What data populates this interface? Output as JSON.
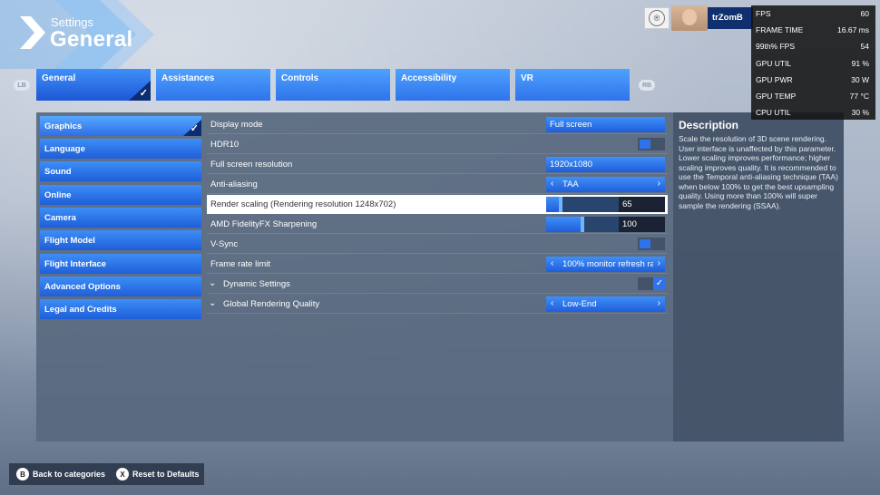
{
  "header": {
    "subtitle": "Settings",
    "title": "General"
  },
  "bumpers": {
    "left": "LB",
    "right": "RB"
  },
  "tabs": [
    {
      "label": "General",
      "active": true
    },
    {
      "label": "Assistances"
    },
    {
      "label": "Controls"
    },
    {
      "label": "Accessibility"
    },
    {
      "label": "VR"
    }
  ],
  "categories": [
    {
      "label": "Graphics",
      "active": true
    },
    {
      "label": "Language"
    },
    {
      "label": "Sound"
    },
    {
      "label": "Online"
    },
    {
      "label": "Camera"
    },
    {
      "label": "Flight Model"
    },
    {
      "label": "Flight Interface"
    },
    {
      "label": "Advanced Options"
    },
    {
      "label": "Legal and Credits"
    }
  ],
  "settings": {
    "display_mode": {
      "label": "Display mode",
      "value": "Full screen"
    },
    "hdr10": {
      "label": "HDR10",
      "enabled": true
    },
    "resolution": {
      "label": "Full screen resolution",
      "value": "1920x1080"
    },
    "anti_aliasing": {
      "label": "Anti-aliasing",
      "value": "TAA"
    },
    "render_scaling": {
      "label": "Render scaling (Rendering resolution 1248x702)",
      "value": "65"
    },
    "sharpening": {
      "label": "AMD FidelityFX Sharpening",
      "value": "100"
    },
    "vsync": {
      "label": "V-Sync",
      "enabled": true
    },
    "frame_rate_limit": {
      "label": "Frame rate limit",
      "value": "100% monitor refresh rat"
    },
    "dynamic_settings": {
      "label": "Dynamic Settings",
      "checked": true
    },
    "global_quality": {
      "label": "Global Rendering Quality",
      "value": "Low-End"
    }
  },
  "description": {
    "title": "Description",
    "text": "Scale the resolution of 3D scene rendering. User interface is unaffected by this parameter. Lower scaling improves performance; higher scaling improves quality. It is recommended to use the Temporal anti-aliasing technique (TAA) when below 100% to get the best upsampling quality. Using more than 100% will super sample the rendering (SSAA)."
  },
  "profile": {
    "username": "trZomB"
  },
  "fps_overlay": [
    {
      "key": "FPS",
      "value": "60"
    },
    {
      "key": "FRAME TIME",
      "value": "16.67 ms"
    },
    {
      "key": "99th% FPS",
      "value": "54"
    },
    {
      "key": "GPU UTIL",
      "value": "91 %"
    },
    {
      "key": "GPU PWR",
      "value": "30 W"
    },
    {
      "key": "GPU TEMP",
      "value": "77 °C"
    },
    {
      "key": "CPU UTIL",
      "value": "30 %"
    }
  ],
  "footer": {
    "back": {
      "button": "B",
      "label": "Back to categories"
    },
    "reset": {
      "button": "X",
      "label": "Reset to Defaults"
    }
  },
  "colors": {
    "accent": "#2f73ea",
    "accent_light": "#4fa1ff",
    "selected_dark": "#0c2d73"
  }
}
